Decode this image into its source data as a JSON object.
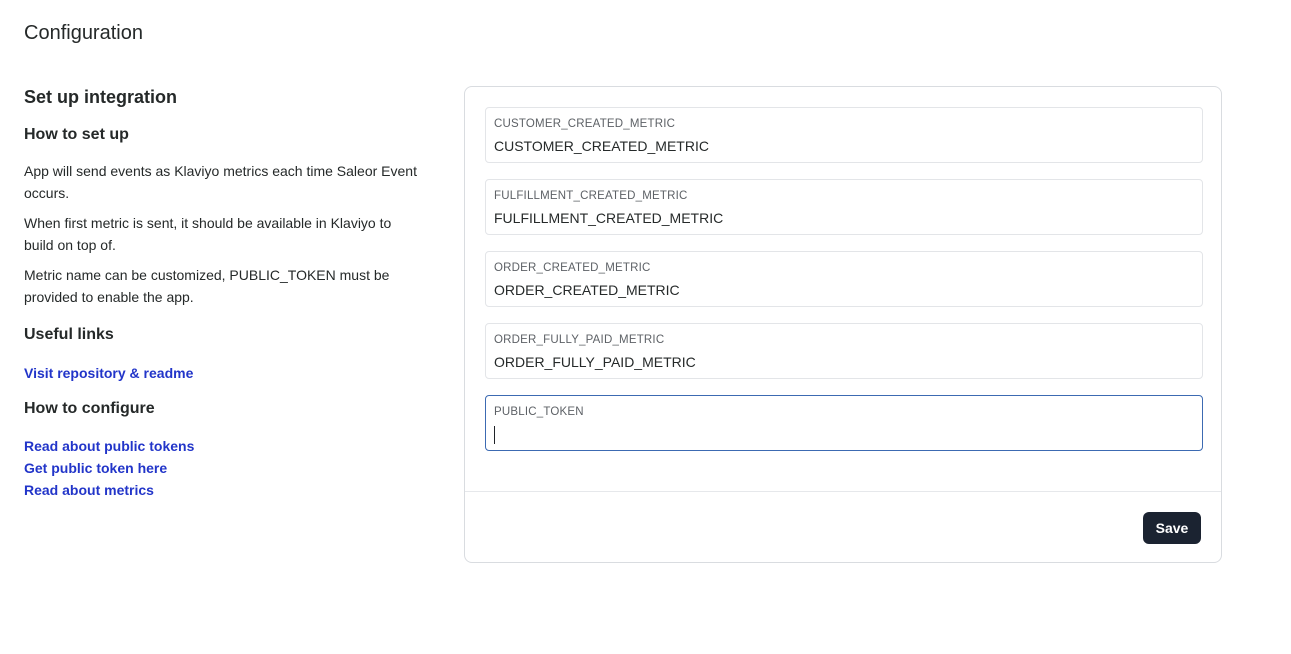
{
  "page": {
    "title": "Configuration"
  },
  "info": {
    "setup_heading": "Set up integration",
    "how_to_setup_heading": "How to set up",
    "paragraphs": [
      "App will send events as Klaviyo metrics each time Saleor Event occurs.",
      "When first metric is sent, it should be available in Klaviyo to build on top of.",
      "Metric name can be customized, PUBLIC_TOKEN must be provided to enable the app."
    ],
    "useful_links_heading": "Useful links",
    "repo_link": "Visit repository & readme",
    "how_to_configure_heading": "How to configure",
    "config_links": [
      "Read about public tokens",
      "Get public token here",
      "Read about metrics"
    ]
  },
  "form": {
    "fields": [
      {
        "label": "CUSTOMER_CREATED_METRIC",
        "value": "CUSTOMER_CREATED_METRIC"
      },
      {
        "label": "FULFILLMENT_CREATED_METRIC",
        "value": "FULFILLMENT_CREATED_METRIC"
      },
      {
        "label": "ORDER_CREATED_METRIC",
        "value": "ORDER_CREATED_METRIC"
      },
      {
        "label": "ORDER_FULLY_PAID_METRIC",
        "value": "ORDER_FULLY_PAID_METRIC"
      },
      {
        "label": "PUBLIC_TOKEN",
        "value": ""
      }
    ],
    "save_label": "Save"
  },
  "colors": {
    "link": "#2235c9",
    "button_bg": "#1b2331",
    "focus_border": "#3c6ab2"
  }
}
